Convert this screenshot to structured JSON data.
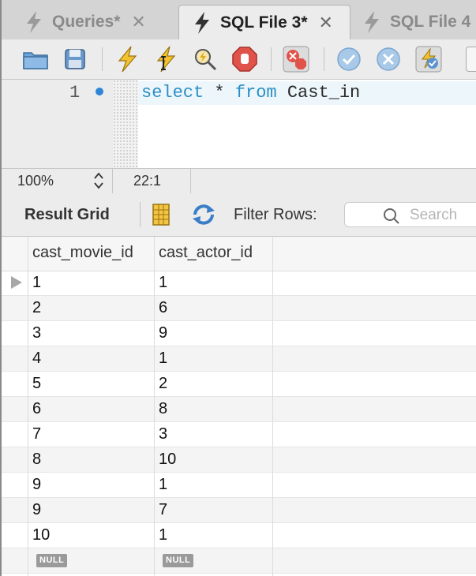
{
  "tabs": [
    {
      "label": "Queries*",
      "close": "✕"
    },
    {
      "label": "SQL File 3*",
      "close": "✕"
    },
    {
      "label": "SQL File 4"
    }
  ],
  "editor": {
    "line_number": "1",
    "kw_select": "select",
    "star": " * ",
    "kw_from": "from",
    "table": " Cast_in"
  },
  "status": {
    "zoom": "100%",
    "position": "22:1"
  },
  "results": {
    "label": "Result Grid",
    "filter_label": "Filter Rows:",
    "search_placeholder": "Search"
  },
  "grid": {
    "columns": [
      "cast_movie_id",
      "cast_actor_id"
    ],
    "rows": [
      [
        "1",
        "1"
      ],
      [
        "2",
        "6"
      ],
      [
        "3",
        "9"
      ],
      [
        "4",
        "1"
      ],
      [
        "5",
        "2"
      ],
      [
        "6",
        "8"
      ],
      [
        "7",
        "3"
      ],
      [
        "8",
        "10"
      ],
      [
        "9",
        "1"
      ],
      [
        "9",
        "7"
      ],
      [
        "10",
        "1"
      ]
    ],
    "null_label": "NULL"
  },
  "colors": {
    "keyword": "#2b8fc4",
    "tab_active_bg": "#ececec"
  }
}
